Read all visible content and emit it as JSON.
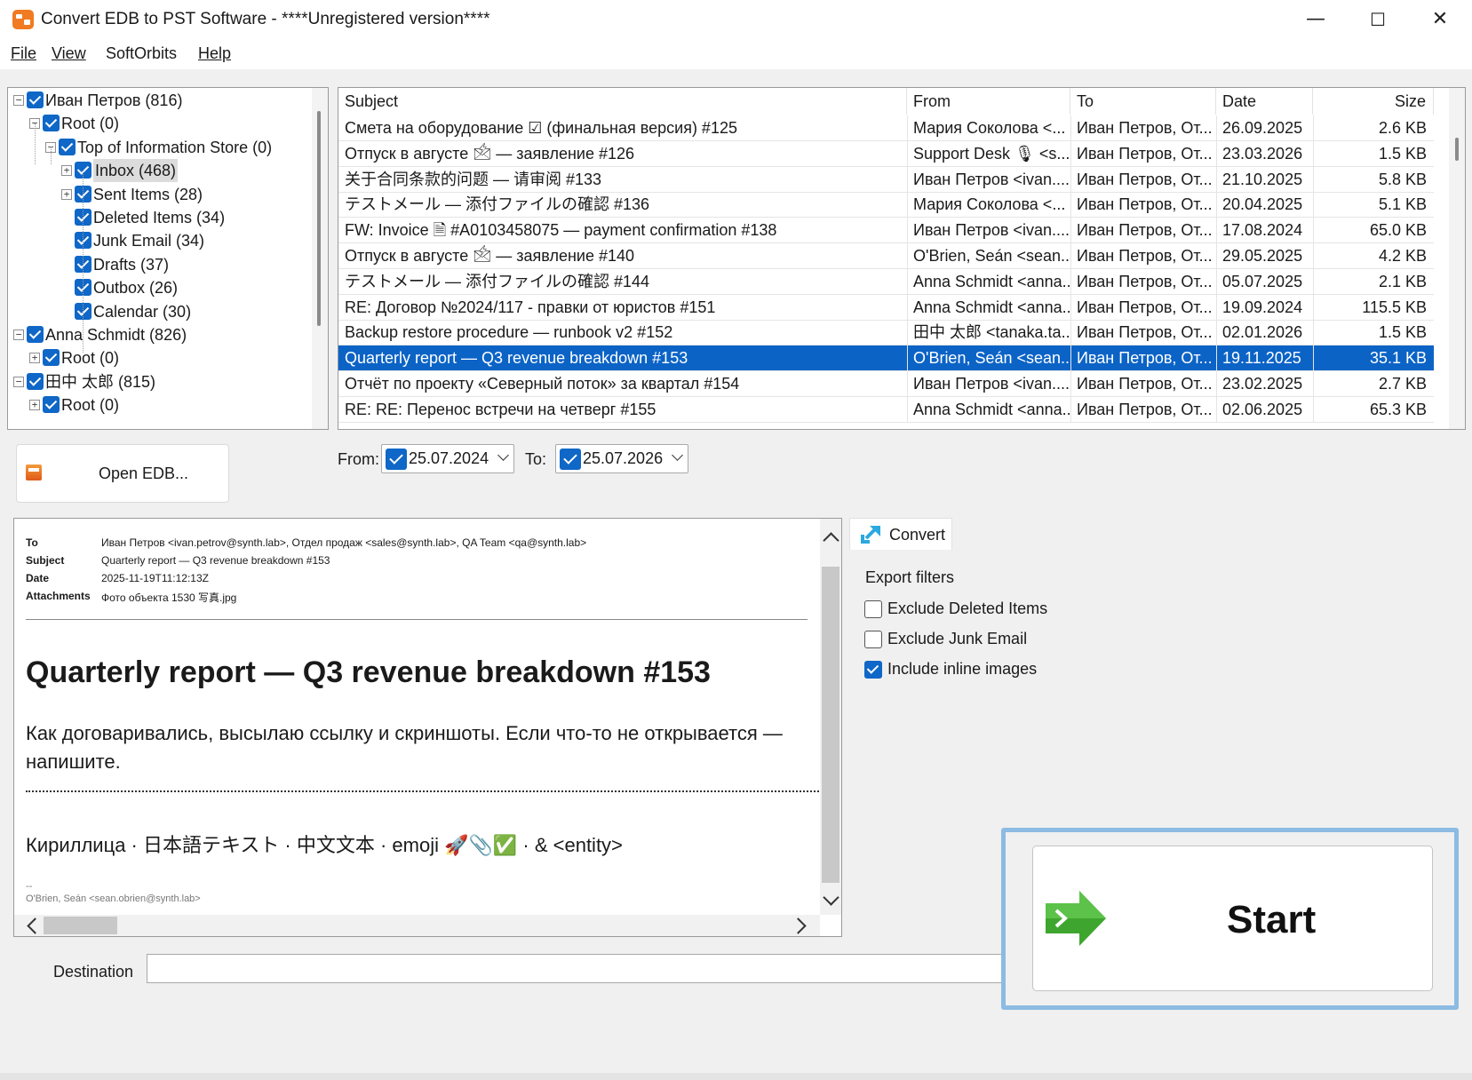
{
  "window": {
    "title": "Convert EDB to PST Software - ****Unregistered version****",
    "controls": {
      "minimize": "—",
      "maximize": "☐",
      "close": "✕"
    }
  },
  "menu": [
    "File",
    "View",
    "SoftOrbits",
    "Help"
  ],
  "tree": [
    {
      "level": 0,
      "expander": "−",
      "checked": true,
      "label": "Иван Петров  (816)"
    },
    {
      "level": 1,
      "expander": "−",
      "checked": true,
      "label": "Root  (0)"
    },
    {
      "level": 2,
      "expander": "−",
      "checked": true,
      "label": "Top of Information Store  (0)"
    },
    {
      "level": 3,
      "expander": "+",
      "checked": true,
      "label": "Inbox  (468)",
      "selected": true
    },
    {
      "level": 3,
      "expander": "+",
      "checked": true,
      "label": "Sent Items  (28)"
    },
    {
      "level": 3,
      "expander": "",
      "checked": true,
      "label": "Deleted Items  (34)"
    },
    {
      "level": 3,
      "expander": "",
      "checked": true,
      "label": "Junk Email  (34)"
    },
    {
      "level": 3,
      "expander": "",
      "checked": true,
      "label": "Drafts  (37)"
    },
    {
      "level": 3,
      "expander": "",
      "checked": true,
      "label": "Outbox  (26)"
    },
    {
      "level": 3,
      "expander": "",
      "checked": true,
      "label": "Calendar  (30)"
    },
    {
      "level": 0,
      "expander": "−",
      "checked": true,
      "label": "Anna Schmidt  (826)"
    },
    {
      "level": 1,
      "expander": "+",
      "checked": true,
      "label": "Root  (0)"
    },
    {
      "level": 0,
      "expander": "−",
      "checked": true,
      "label": "田中 太郎  (815)"
    },
    {
      "level": 1,
      "expander": "+",
      "checked": true,
      "label": "Root  (0)"
    }
  ],
  "grid": {
    "columns": [
      "Subject",
      "From",
      "To",
      "Date",
      "Size"
    ],
    "rows": [
      [
        "Смета на оборудование ☑ (финальная версия) #125",
        "Мария Соколова <...",
        "Иван Петров, От...",
        "26.09.2025",
        "2.6 KB"
      ],
      [
        "Отпуск в августе 🖄 — заявление #126",
        "Support Desk 🎙 <s...",
        "Иван Петров, От...",
        "23.03.2026",
        "1.5 KB"
      ],
      [
        "关于合同条款的问题 — 请审阅 #133",
        "Иван Петров <ivan....",
        "Иван Петров, От...",
        "21.10.2025",
        "5.8 KB"
      ],
      [
        "テストメール — 添付ファイルの確認 #136",
        "Мария Соколова <...",
        "Иван Петров, От...",
        "20.04.2025",
        "5.1 KB"
      ],
      [
        "FW: Invoice 🗎 #A0103458075 — payment confirmation #138",
        "Иван Петров <ivan....",
        "Иван Петров, От...",
        "17.08.2024",
        "65.0 KB"
      ],
      [
        "Отпуск в августе 🖄 — заявление #140",
        "O'Brien, Seán <sean....",
        "Иван Петров, От...",
        "29.05.2025",
        "4.2 KB"
      ],
      [
        "テストメール — 添付ファイルの確認 #144",
        "Anna Schmidt <anna...",
        "Иван Петров, От...",
        "05.07.2025",
        "2.1 KB"
      ],
      [
        "RE: Договор №2024/117 - правки от юристов #151",
        "Anna Schmidt <anna...",
        "Иван Петров, От...",
        "19.09.2024",
        "115.5 KB"
      ],
      [
        "Backup restore procedure — runbook v2 #152",
        "田中 太郎 <tanaka.ta...",
        "Иван Петров, От...",
        "02.01.2026",
        "1.5 KB"
      ],
      [
        "Quarterly report — Q3 revenue breakdown #153",
        "O'Brien, Seán <sean....",
        "Иван Петров, От...",
        "19.11.2025",
        "35.1 KB"
      ],
      [
        "Отчёт по проекту «Северный поток» за квартал #154",
        "Иван Петров <ivan....",
        "Иван Петров, От...",
        "23.02.2025",
        "2.7 KB"
      ],
      [
        "RE: RE: Перенос встречи на четверг #155",
        "Anna Schmidt <anna...",
        "Иван Петров, От...",
        "02.06.2025",
        "65.3 KB"
      ]
    ],
    "selected_index": 9
  },
  "open_button": {
    "label": "Open EDB..."
  },
  "date_filter": {
    "from_label": "From:",
    "from_value": "25.07.2024",
    "to_label": "To:",
    "to_value": "25.07.2026"
  },
  "preview": {
    "headers": [
      {
        "key": "To",
        "value": "Иван Петров <ivan.petrov@synth.lab>, Отдел продаж <sales@synth.lab>, QA Team <qa@synth.lab>"
      },
      {
        "key": "Subject",
        "value": "Quarterly report — Q3 revenue breakdown #153"
      },
      {
        "key": "Date",
        "value": "2025-11-19T11:12:13Z"
      },
      {
        "key": "Attachments",
        "value": "Фото объекта 1530 写真.jpg"
      }
    ],
    "heading": "Quarterly report — Q3 revenue breakdown #153",
    "body": "Как договаривались, высылаю ссылку и скриншоты. Если что-то не открывается — напишите.",
    "mixed_line": "Кириллица · 日本語テキスト · 中文文本 · emoji 🚀📎✅ · & <entity>",
    "sig_dash": "--",
    "signature": "O'Brien, Seán <sean.obrien@synth.lab>"
  },
  "convert": {
    "tab_label": "Convert",
    "filters_title": "Export filters",
    "options": [
      {
        "label": "Exclude Deleted Items",
        "checked": false
      },
      {
        "label": "Exclude Junk Email",
        "checked": false
      },
      {
        "label": "Include inline images",
        "checked": true
      }
    ]
  },
  "destination": {
    "label": "Destination",
    "value": ""
  },
  "start_button": {
    "label": "Start"
  },
  "colors": {
    "selection": "#0b63c6",
    "checkbox": "#0f67c7",
    "accent_orange": "#f07b22",
    "start_arrow": "#3ea62e",
    "start_focus": "#8cbbe3"
  }
}
